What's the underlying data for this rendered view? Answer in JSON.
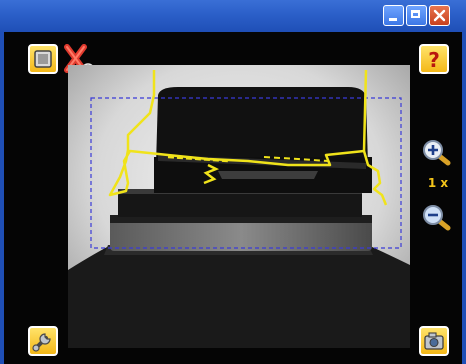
{
  "window": {
    "controls": {
      "minimize": "minimize-icon",
      "maximize": "maximize-icon",
      "close": "close-icon"
    }
  },
  "toolbar": {
    "stop_icon": "stop-icon",
    "no_connection_icon": "disconnected-icon",
    "help_icon": "question-mark-icon",
    "tools_icon": "wrench-icon",
    "snapshot_icon": "camera-icon"
  },
  "zoom": {
    "in_icon": "zoom-in-icon",
    "out_icon": "zoom-out-icon",
    "level": "1 x"
  },
  "colors": {
    "titlebar": "#2b5fc8",
    "accent_yellow": "#f4c21a",
    "roi_dashed": "#3a3ad8",
    "edge_trace": "#f0e31a",
    "background": "#050505"
  }
}
